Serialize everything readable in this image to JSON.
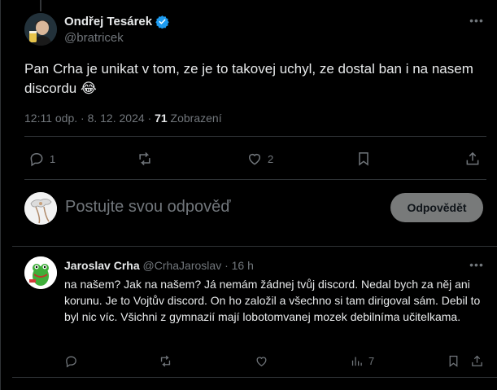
{
  "main_tweet": {
    "author_name": "Ondřej Tesárek",
    "author_handle": "@bratricek",
    "text": "Pan Crha je unikat v tom, ze je to takovej uchyl, ze dostal ban i na nasem discordu",
    "emoji": "😂",
    "time": "12:11 odp. · 8. 12. 2024 ·",
    "views_count": "71",
    "views_label": "Zobrazení",
    "replies_count": "1",
    "likes_count": "2"
  },
  "composer": {
    "placeholder": "Postujte svou odpověď",
    "reply_button": "Odpovědět"
  },
  "reply_tweet": {
    "author_name": "Jaroslav Crha",
    "author_handle": "@CrhaJaroslav",
    "time": "· 16 h",
    "text": "na našem? Jak na našem? Já nemám žádnej tvůj discord. Nedal bych za něj ani korunu. Je to Vojtův discord. On ho založil a všechno si tam dirigoval sám. Debil to byl nic víc. Všichni z gymnazií mají lobotomvanej mozek debilníma učitelkama.",
    "views_count": "7"
  },
  "colors": {
    "background": "#000000",
    "text_primary": "#e7e9ea",
    "text_secondary": "#71767b",
    "divider": "#2f3336",
    "verified_blue": "#1d9bf0"
  }
}
